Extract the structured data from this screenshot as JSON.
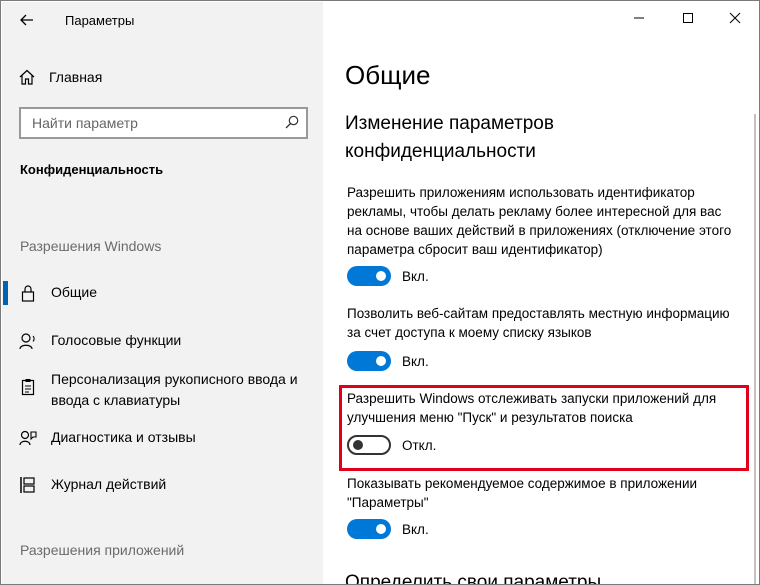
{
  "window": {
    "title": "Параметры",
    "caption_icons": [
      "minimize-icon",
      "maximize-icon",
      "close-icon"
    ]
  },
  "sidebar": {
    "home_label": "Главная",
    "search_placeholder": "Найти параметр",
    "category": "Конфиденциальность",
    "section_windows": "Разрешения Windows",
    "items": [
      {
        "label": "Общие",
        "icon": "lock-icon",
        "selected": true
      },
      {
        "label": "Голосовые функции",
        "icon": "speech-icon",
        "selected": false
      },
      {
        "label": "Персонализация рукописного ввода и ввода с клавиатуры",
        "icon": "clipboard-icon",
        "selected": false
      },
      {
        "label": "Диагностика и отзывы",
        "icon": "feedback-icon",
        "selected": false
      },
      {
        "label": "Журнал действий",
        "icon": "timeline-icon",
        "selected": false
      }
    ],
    "section_apps": "Разрешения приложений"
  },
  "main": {
    "title": "Общие",
    "subtitle": "Изменение параметров конфиденциальности",
    "settings": [
      {
        "description": "Разрешить приложениям использовать идентификатор рекламы, чтобы делать рекламу более интересной для вас на основе ваших действий в приложениях (отключение этого параметра сбросит ваш идентификатор)",
        "state": "Вкл.",
        "on": true
      },
      {
        "description": "Позволить веб-сайтам предоставлять местную информацию за счет доступа к моему списку языков",
        "state": "Вкл.",
        "on": true
      },
      {
        "description": "Разрешить Windows отслеживать запуски приложений для улучшения меню \"Пуск\" и результатов поиска",
        "state": "Откл.",
        "on": false
      },
      {
        "description": "Показывать рекомендуемое содержимое в приложении \"Параметры\"",
        "state": "Вкл.",
        "on": true
      }
    ],
    "next_section_title": "Определить свои параметры"
  },
  "colors": {
    "accent": "#0078d7",
    "sidebar_bg": "#f2f2f2",
    "highlight": "#e0001b"
  }
}
